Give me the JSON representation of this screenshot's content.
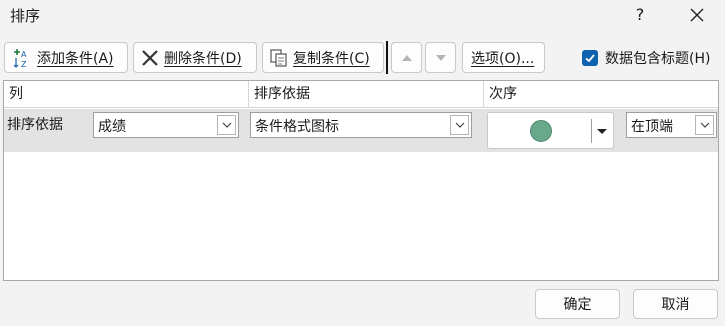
{
  "dialog": {
    "title": "排序",
    "help": "?"
  },
  "toolbar": {
    "add_label": "添加条件(A)",
    "delete_label": "删除条件(D)",
    "copy_label": "复制条件(C)",
    "options_label": "选项(O)...",
    "has_header_label": "数据包含标题(H)",
    "has_header_checked": true
  },
  "grid": {
    "headers": {
      "column": "列",
      "sort_on": "排序依据",
      "order": "次序"
    },
    "rows": [
      {
        "label": "排序依据",
        "column": "成绩",
        "sort_on": "条件格式图标",
        "icon": "green-circle-icon",
        "icon_color": "#6aa88c",
        "position": "在顶端"
      }
    ]
  },
  "footer": {
    "ok_label": "确定",
    "cancel_label": "取消"
  },
  "colors": {
    "accent": "#0f62b0",
    "selected_row": "#e3e3e3"
  }
}
